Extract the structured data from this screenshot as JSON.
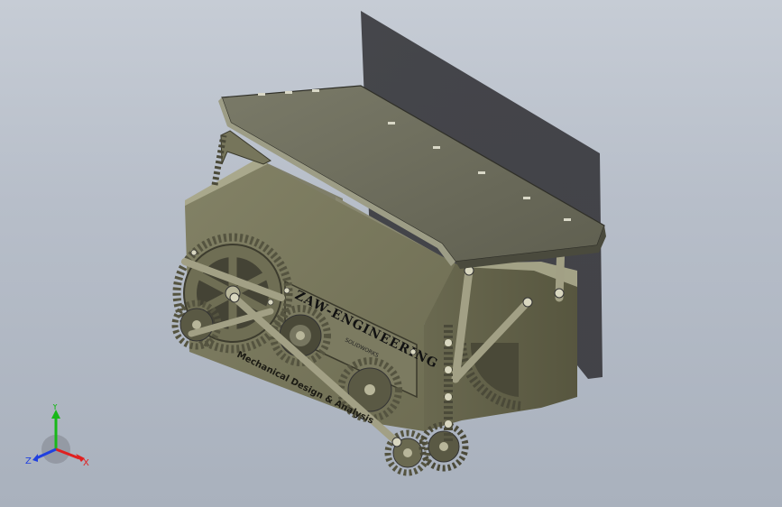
{
  "model": {
    "brand": "ZAW-ENGINEERING",
    "sub_brand": "SOLIDWORKS",
    "motto": "Mechanical Design & Analysis"
  },
  "triad": {
    "x_label": "X",
    "y_label": "Y",
    "z_label": "Z",
    "x_color": "#e02020",
    "y_color": "#18b818",
    "z_color": "#2040e0"
  },
  "colors": {
    "body": "#7b7a5e",
    "body_dark": "#5f5e47",
    "body_light": "#9b9a7d",
    "lid": "#6b6b5a",
    "shadow": "#3b3b3e"
  }
}
